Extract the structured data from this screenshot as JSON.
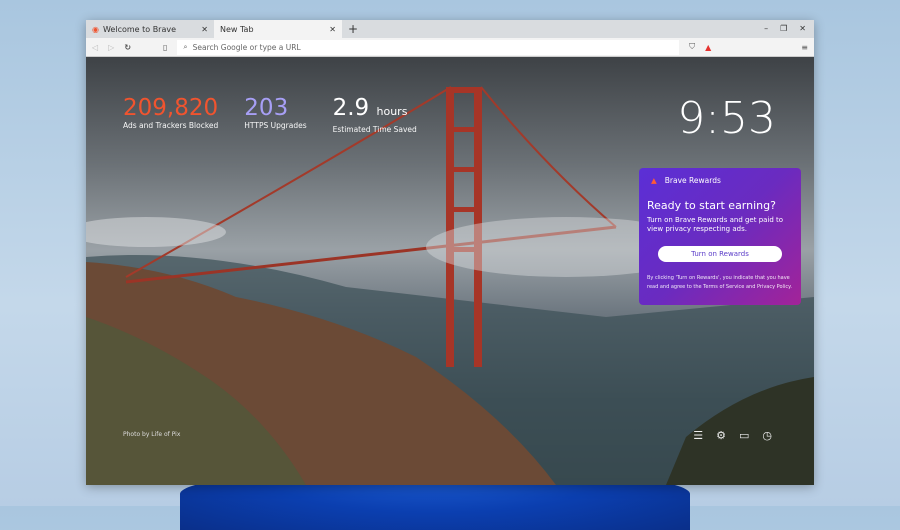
{
  "tabs": [
    {
      "title": "Welcome to Brave",
      "icon": "brave-lion-icon",
      "active": false
    },
    {
      "title": "New Tab",
      "active": true
    }
  ],
  "toolbar": {
    "url_placeholder": "Search Google or type a URL",
    "rewards_badge_color": "#e5322f"
  },
  "stats": [
    {
      "value": "209,820",
      "label": "Ads and Trackers Blocked",
      "color": "#f0542f"
    },
    {
      "value": "203",
      "label": "HTTPS Upgrades",
      "color": "#a79ff5"
    },
    {
      "value": "2.9",
      "unit": "hours",
      "label": "Estimated Time Saved",
      "color": "#ffffff"
    }
  ],
  "clock": "9:53",
  "rewards": {
    "title": "Brave Rewards",
    "heading": "Ready to start earning?",
    "body": "Turn on Brave Rewards and get paid to view privacy respecting ads.",
    "button": "Turn on Rewards",
    "fine_print": "By clicking 'Turn on Rewards', you indicate that you have read and agree to the Terms of Service and Privacy Policy."
  },
  "photo_credit": "Photo by Life of Pix",
  "bottom_icons": [
    "customize-icon",
    "settings-icon",
    "bookmarks-icon",
    "history-icon"
  ]
}
